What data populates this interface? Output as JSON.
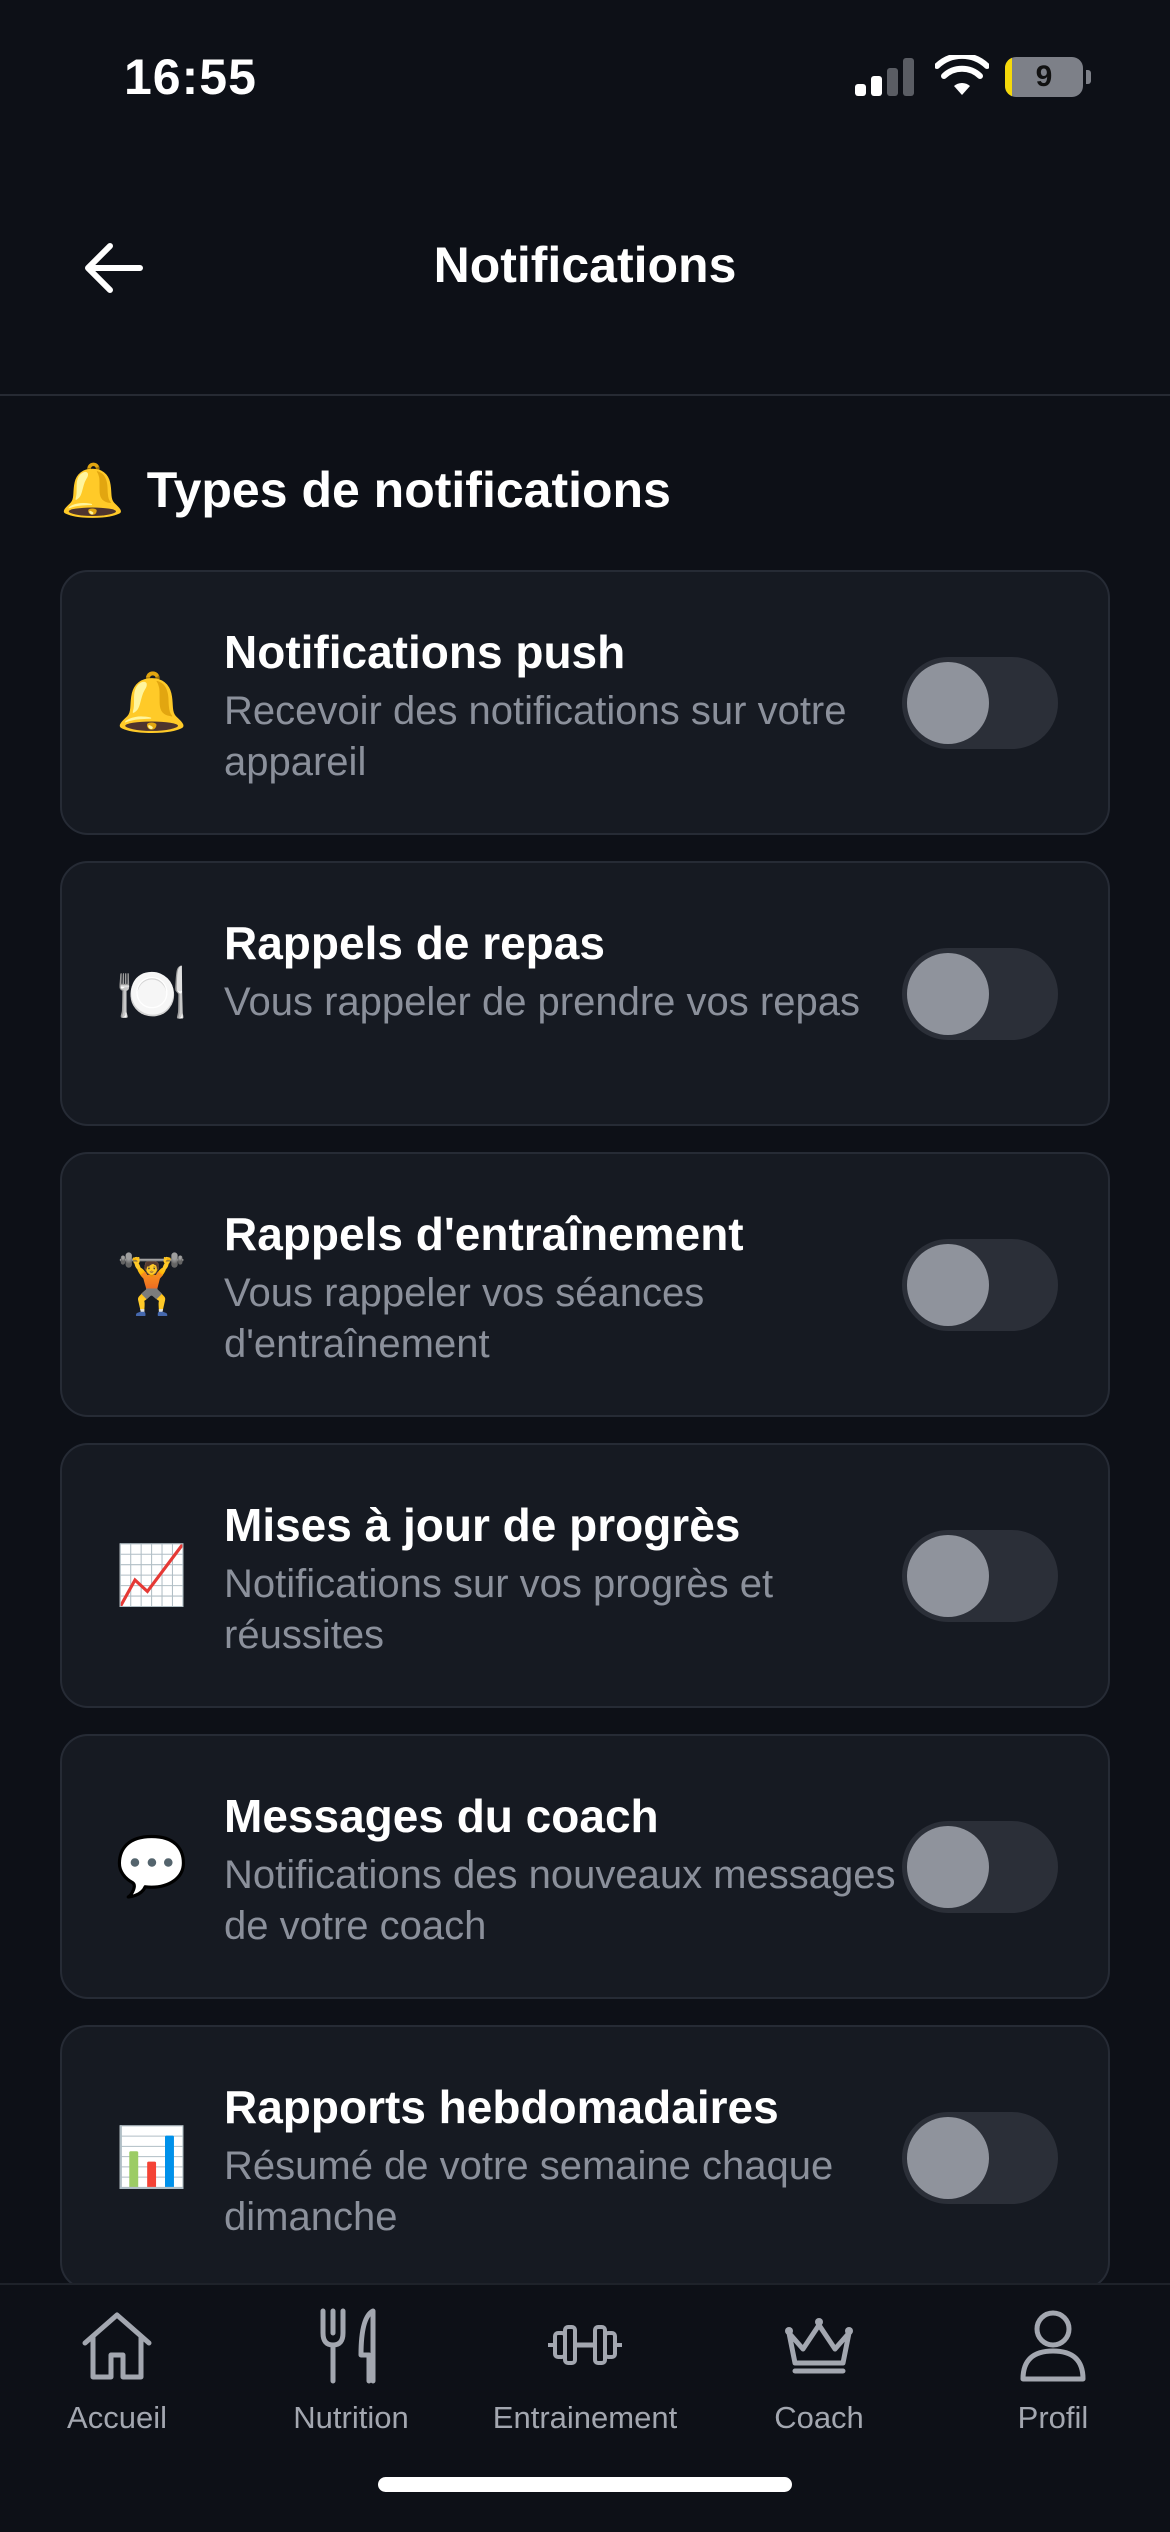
{
  "status_bar": {
    "time": "16:55",
    "battery_level": "9",
    "battery_fraction": 0.09,
    "signal_bars": 2
  },
  "header": {
    "title": "Notifications",
    "back_icon": "arrow-left-icon"
  },
  "section": {
    "emoji": "🔔",
    "title": "Types de notifications"
  },
  "settings": [
    {
      "id": "push",
      "icon": "🔔",
      "title": "Notifications push",
      "description": "Recevoir des notifications sur votre appareil",
      "enabled": false
    },
    {
      "id": "meals",
      "icon": "🍽️",
      "title": "Rappels de repas",
      "description": "Vous rappeler de prendre vos repas",
      "enabled": false
    },
    {
      "id": "workouts",
      "icon": "🏋️",
      "title": "Rappels d'entraînement",
      "description": "Vous rappeler vos séances d'entraînement",
      "enabled": false
    },
    {
      "id": "progress",
      "icon": "📈",
      "title": "Mises à jour de progrès",
      "description": "Notifications sur vos progrès et réussites",
      "enabled": false
    },
    {
      "id": "coach",
      "icon": "💬",
      "title": "Messages du coach",
      "description": "Notifications des nouveaux messages de votre coach",
      "enabled": false
    },
    {
      "id": "weekly",
      "icon": "📊",
      "title": "Rapports hebdomadaires",
      "description": "Résumé de votre semaine chaque dimanche",
      "enabled": false
    }
  ],
  "bottom_nav": [
    {
      "label": "Accueil",
      "icon": "home-icon"
    },
    {
      "label": "Nutrition",
      "icon": "fork-knife-icon"
    },
    {
      "label": "Entrainement",
      "icon": "dumbbell-icon"
    },
    {
      "label": "Coach",
      "icon": "crown-icon"
    },
    {
      "label": "Profil",
      "icon": "user-icon"
    }
  ],
  "colors": {
    "background": "#0d1017",
    "card": "#161a22",
    "card_border": "#262b35",
    "toggle_off": "#2b2f38",
    "knob": "#8f939c",
    "muted_text": "#8b909b",
    "battery_fill": "#f5d90a"
  }
}
